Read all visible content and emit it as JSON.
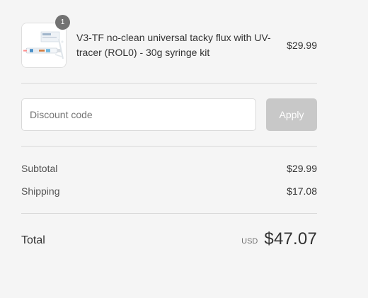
{
  "product": {
    "quantity": "1",
    "name": "V3-TF no-clean universal tacky flux with UV-tracer (ROL0) - 30g syringe kit",
    "price": "$29.99",
    "image": "product-thumbnail"
  },
  "discount": {
    "placeholder": "Discount code",
    "apply_label": "Apply"
  },
  "costs": {
    "subtotal_label": "Subtotal",
    "subtotal_value": "$29.99",
    "shipping_label": "Shipping",
    "shipping_value": "$17.08"
  },
  "total": {
    "label": "Total",
    "currency": "USD",
    "amount": "$47.07"
  },
  "colors": {
    "background": "#f5f5f5",
    "badge": "#727272",
    "apply_disabled": "#c8c8c8",
    "divider": "#d9d9d9"
  }
}
